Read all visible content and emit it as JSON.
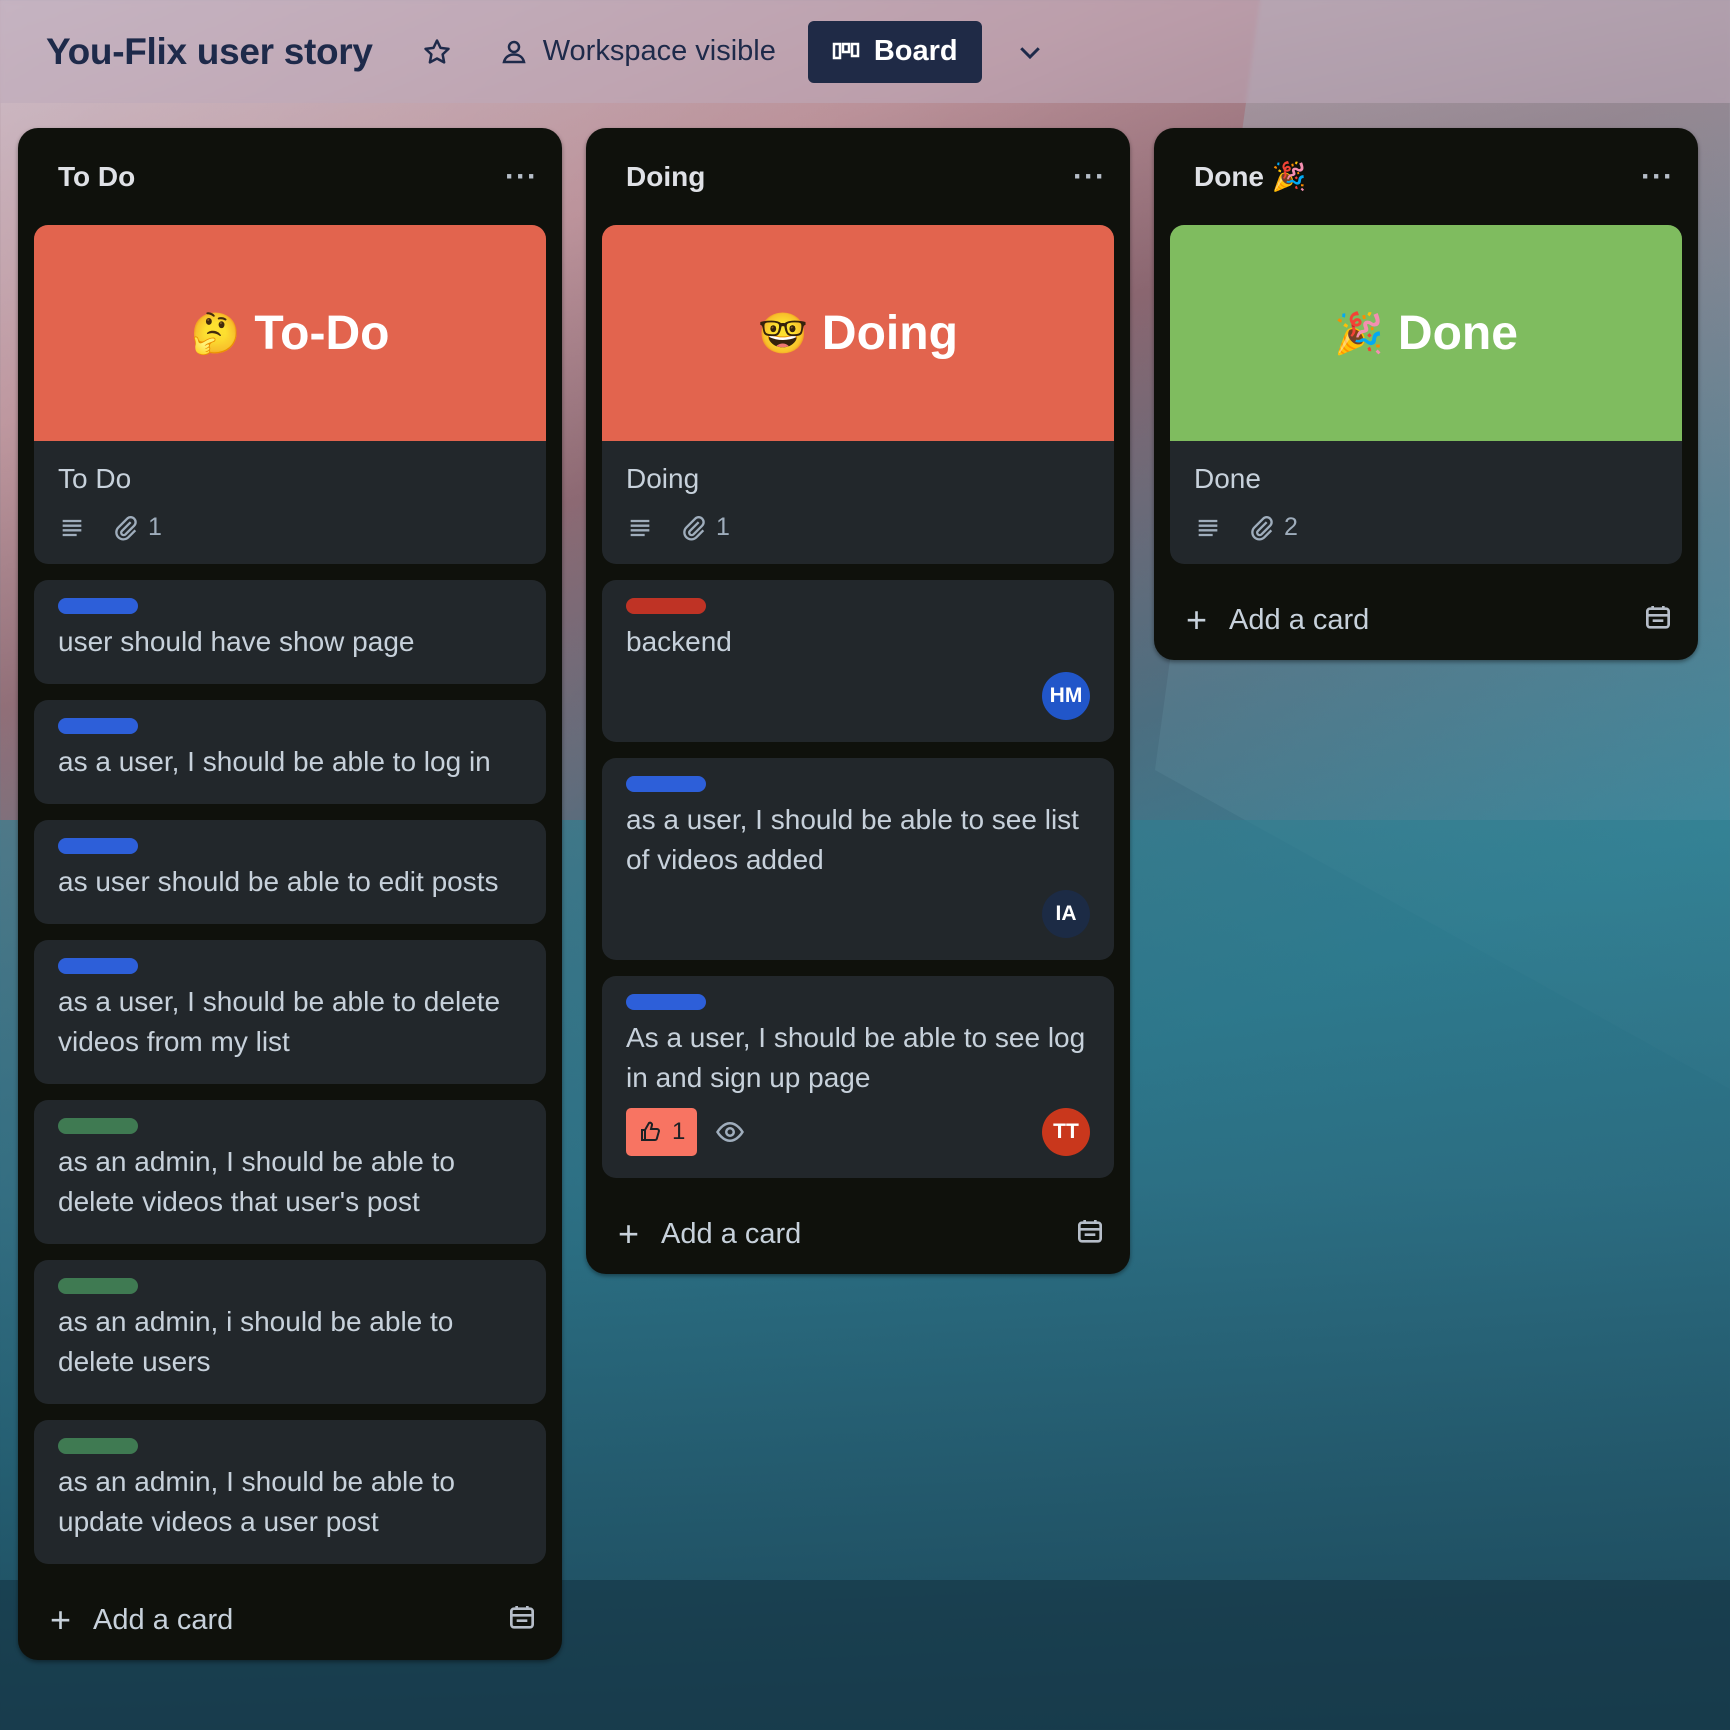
{
  "colors": {
    "cover_todo": "#e2644e",
    "cover_doing": "#e2644e",
    "cover_done": "#7fbc5f",
    "label_blue": "#2d5fd9",
    "label_green": "#3f7a52",
    "label_red": "#bf3325",
    "avatar_hm": "#2156c9",
    "avatar_ia": "#1c2b45",
    "avatar_tt": "#c9371c"
  },
  "header": {
    "board_title": "You-Flix user story",
    "visibility": "Workspace visible",
    "view": "Board"
  },
  "lists": [
    {
      "title": "To Do",
      "menu": "···",
      "cover_card": {
        "cover_text": "To-Do",
        "cover_emoji": "🤔",
        "title": "To Do",
        "attachments": "1"
      },
      "cards": [
        {
          "title": "user should have show page"
        },
        {
          "title": "as a user, I should be able to log in"
        },
        {
          "title": "as user should be able to edit posts"
        },
        {
          "title": "as a user, I should be able to delete videos from my list"
        },
        {
          "title": "as an admin, I should be able to delete videos that user's post"
        },
        {
          "title": "as an admin, i should be able to delete users"
        },
        {
          "title": "as an admin, I should be able to update videos a user post"
        }
      ],
      "add_card": "Add a card"
    },
    {
      "title": "Doing",
      "menu": "···",
      "cover_card": {
        "cover_text": "Doing",
        "cover_emoji": "🤓",
        "title": "Doing",
        "attachments": "1"
      },
      "cards": [
        {
          "title": "backend",
          "avatar": "HM"
        },
        {
          "title": "as a user, I should be able to see list of videos added",
          "avatar": "IA"
        },
        {
          "title": "As a user, I should be able to see log in and sign up page",
          "avatar": "TT",
          "votes": "1"
        }
      ],
      "add_card": "Add a card"
    },
    {
      "title": "Done 🎉",
      "menu": "···",
      "cover_card": {
        "cover_text": "Done",
        "cover_emoji": "🎉",
        "title": "Done",
        "attachments": "2"
      },
      "add_card": "Add a card"
    }
  ]
}
